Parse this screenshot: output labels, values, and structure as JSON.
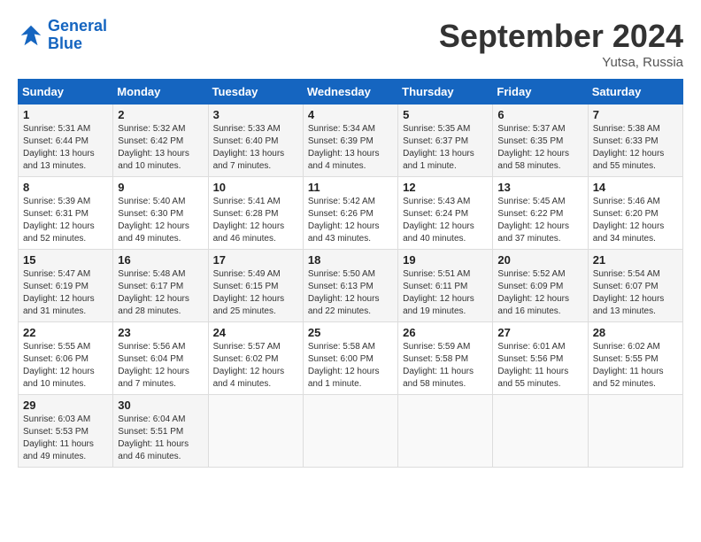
{
  "header": {
    "logo_line1": "General",
    "logo_line2": "Blue",
    "month_year": "September 2024",
    "location": "Yutsa, Russia"
  },
  "weekdays": [
    "Sunday",
    "Monday",
    "Tuesday",
    "Wednesday",
    "Thursday",
    "Friday",
    "Saturday"
  ],
  "weeks": [
    [
      {
        "day": "1",
        "text": "Sunrise: 5:31 AM\nSunset: 6:44 PM\nDaylight: 13 hours\nand 13 minutes."
      },
      {
        "day": "2",
        "text": "Sunrise: 5:32 AM\nSunset: 6:42 PM\nDaylight: 13 hours\nand 10 minutes."
      },
      {
        "day": "3",
        "text": "Sunrise: 5:33 AM\nSunset: 6:40 PM\nDaylight: 13 hours\nand 7 minutes."
      },
      {
        "day": "4",
        "text": "Sunrise: 5:34 AM\nSunset: 6:39 PM\nDaylight: 13 hours\nand 4 minutes."
      },
      {
        "day": "5",
        "text": "Sunrise: 5:35 AM\nSunset: 6:37 PM\nDaylight: 13 hours\nand 1 minute."
      },
      {
        "day": "6",
        "text": "Sunrise: 5:37 AM\nSunset: 6:35 PM\nDaylight: 12 hours\nand 58 minutes."
      },
      {
        "day": "7",
        "text": "Sunrise: 5:38 AM\nSunset: 6:33 PM\nDaylight: 12 hours\nand 55 minutes."
      }
    ],
    [
      {
        "day": "8",
        "text": "Sunrise: 5:39 AM\nSunset: 6:31 PM\nDaylight: 12 hours\nand 52 minutes."
      },
      {
        "day": "9",
        "text": "Sunrise: 5:40 AM\nSunset: 6:30 PM\nDaylight: 12 hours\nand 49 minutes."
      },
      {
        "day": "10",
        "text": "Sunrise: 5:41 AM\nSunset: 6:28 PM\nDaylight: 12 hours\nand 46 minutes."
      },
      {
        "day": "11",
        "text": "Sunrise: 5:42 AM\nSunset: 6:26 PM\nDaylight: 12 hours\nand 43 minutes."
      },
      {
        "day": "12",
        "text": "Sunrise: 5:43 AM\nSunset: 6:24 PM\nDaylight: 12 hours\nand 40 minutes."
      },
      {
        "day": "13",
        "text": "Sunrise: 5:45 AM\nSunset: 6:22 PM\nDaylight: 12 hours\nand 37 minutes."
      },
      {
        "day": "14",
        "text": "Sunrise: 5:46 AM\nSunset: 6:20 PM\nDaylight: 12 hours\nand 34 minutes."
      }
    ],
    [
      {
        "day": "15",
        "text": "Sunrise: 5:47 AM\nSunset: 6:19 PM\nDaylight: 12 hours\nand 31 minutes."
      },
      {
        "day": "16",
        "text": "Sunrise: 5:48 AM\nSunset: 6:17 PM\nDaylight: 12 hours\nand 28 minutes."
      },
      {
        "day": "17",
        "text": "Sunrise: 5:49 AM\nSunset: 6:15 PM\nDaylight: 12 hours\nand 25 minutes."
      },
      {
        "day": "18",
        "text": "Sunrise: 5:50 AM\nSunset: 6:13 PM\nDaylight: 12 hours\nand 22 minutes."
      },
      {
        "day": "19",
        "text": "Sunrise: 5:51 AM\nSunset: 6:11 PM\nDaylight: 12 hours\nand 19 minutes."
      },
      {
        "day": "20",
        "text": "Sunrise: 5:52 AM\nSunset: 6:09 PM\nDaylight: 12 hours\nand 16 minutes."
      },
      {
        "day": "21",
        "text": "Sunrise: 5:54 AM\nSunset: 6:07 PM\nDaylight: 12 hours\nand 13 minutes."
      }
    ],
    [
      {
        "day": "22",
        "text": "Sunrise: 5:55 AM\nSunset: 6:06 PM\nDaylight: 12 hours\nand 10 minutes."
      },
      {
        "day": "23",
        "text": "Sunrise: 5:56 AM\nSunset: 6:04 PM\nDaylight: 12 hours\nand 7 minutes."
      },
      {
        "day": "24",
        "text": "Sunrise: 5:57 AM\nSunset: 6:02 PM\nDaylight: 12 hours\nand 4 minutes."
      },
      {
        "day": "25",
        "text": "Sunrise: 5:58 AM\nSunset: 6:00 PM\nDaylight: 12 hours\nand 1 minute."
      },
      {
        "day": "26",
        "text": "Sunrise: 5:59 AM\nSunset: 5:58 PM\nDaylight: 11 hours\nand 58 minutes."
      },
      {
        "day": "27",
        "text": "Sunrise: 6:01 AM\nSunset: 5:56 PM\nDaylight: 11 hours\nand 55 minutes."
      },
      {
        "day": "28",
        "text": "Sunrise: 6:02 AM\nSunset: 5:55 PM\nDaylight: 11 hours\nand 52 minutes."
      }
    ],
    [
      {
        "day": "29",
        "text": "Sunrise: 6:03 AM\nSunset: 5:53 PM\nDaylight: 11 hours\nand 49 minutes."
      },
      {
        "day": "30",
        "text": "Sunrise: 6:04 AM\nSunset: 5:51 PM\nDaylight: 11 hours\nand 46 minutes."
      },
      {
        "day": "",
        "text": ""
      },
      {
        "day": "",
        "text": ""
      },
      {
        "day": "",
        "text": ""
      },
      {
        "day": "",
        "text": ""
      },
      {
        "day": "",
        "text": ""
      }
    ]
  ]
}
